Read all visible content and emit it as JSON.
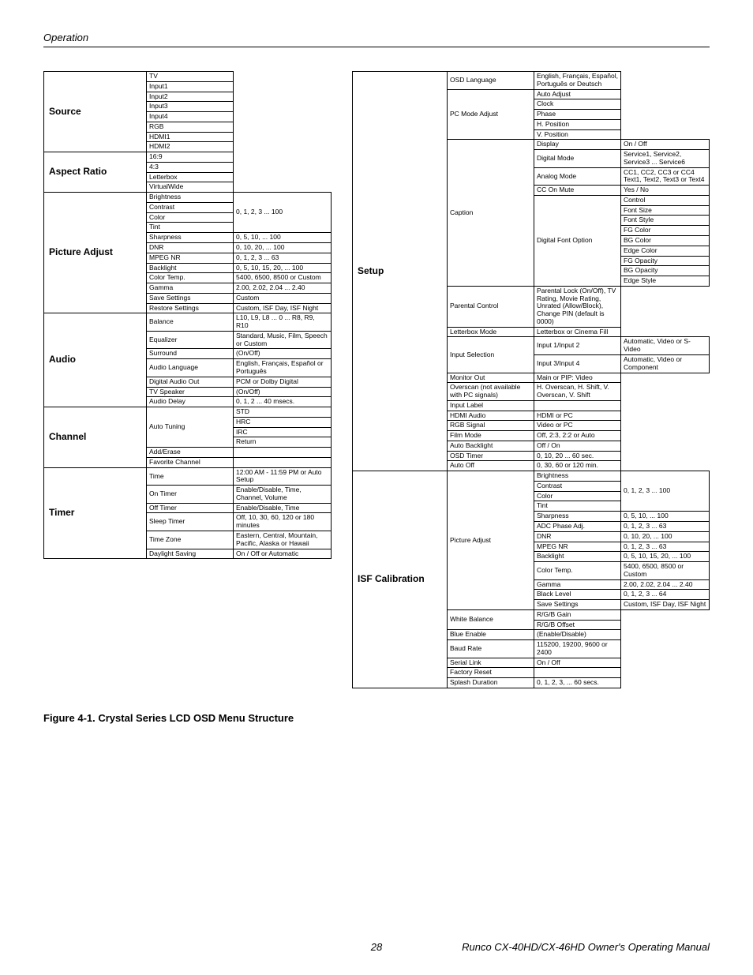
{
  "header": "Operation",
  "figure_caption": "Figure 4-1. Crystal Series LCD OSD Menu Structure",
  "footer_left": "",
  "footer_page": "28",
  "footer_right": "Runco CX-40HD/CX-46HD Owner's Operating Manual",
  "left": {
    "source": {
      "title": "Source",
      "items": [
        "TV",
        "Input1",
        "Input2",
        "Input3",
        "Input4",
        "RGB",
        "HDMI1",
        "HDMI2"
      ]
    },
    "aspect": {
      "title": "Aspect Ratio",
      "items": [
        "16:9",
        "4:3",
        "Letterbox",
        "VirtualWide"
      ]
    },
    "picture": {
      "title": "Picture Adjust",
      "rows": [
        [
          "Brightness",
          ""
        ],
        [
          "Contrast",
          ""
        ],
        [
          "Color",
          ""
        ],
        [
          "Tint",
          ""
        ],
        [
          "Sharpness",
          "0, 5, 10, ... 100"
        ],
        [
          "DNR",
          "0, 10, 20, ... 100"
        ],
        [
          "MPEG NR",
          "0, 1, 2, 3 ... 63"
        ],
        [
          "Backlight",
          "0, 5, 10, 15, 20, ... 100"
        ],
        [
          "Color Temp.",
          "5400, 6500, 8500 or Custom"
        ],
        [
          "Gamma",
          "2.00, 2.02, 2.04 ... 2.40"
        ],
        [
          "Save Settings",
          "Custom"
        ],
        [
          "Restore Settings",
          "Custom, ISF Day, ISF Night"
        ]
      ],
      "mergedVal": "0, 1, 2, 3 ... 100"
    },
    "audio": {
      "title": "Audio",
      "rows": [
        [
          "Balance",
          "L10, L9, L8 ... 0 ... R8, R9, R10"
        ],
        [
          "Equalizer",
          "Standard, Music, Film, Speech or Custom"
        ],
        [
          "Surround",
          "(On/Off)"
        ],
        [
          "Audio Language",
          "English, Français, Español or Português"
        ],
        [
          "Digital Audio Out",
          "PCM or Dolby Digital"
        ],
        [
          "TV Speaker",
          "(On/Off)"
        ],
        [
          "Audio Delay",
          "0, 1, 2 ... 40 msecs."
        ]
      ]
    },
    "channel": {
      "title": "Channel",
      "rows": [
        [
          "Auto Tuning",
          "STD"
        ],
        [
          "",
          "HRC"
        ],
        [
          "",
          "IRC"
        ],
        [
          "",
          "Return"
        ],
        [
          "Add/Erase",
          ""
        ],
        [
          "Favorite Channel",
          ""
        ]
      ]
    },
    "timer": {
      "title": "Timer",
      "rows": [
        [
          "Time",
          "12:00 AM - 11:59 PM or Auto Setup"
        ],
        [
          "On Timer",
          "Enable/Disable, Time, Channel, Volume"
        ],
        [
          "Off Timer",
          "Enable/Disable, Time"
        ],
        [
          "Sleep Timer",
          "Off, 10, 30, 60, 120 or 180 minutes"
        ],
        [
          "Time Zone",
          "Eastern, Central, Mountain, Pacific, Alaska or Hawaii"
        ],
        [
          "Daylight Saving",
          "On / Off or Automatic"
        ]
      ]
    }
  },
  "right": {
    "setup": {
      "title": "Setup",
      "rows": [
        {
          "a": "OSD Language",
          "b": "English, Français, Español, Português or Deutsch",
          "c": "",
          "aSpan": 1,
          "bSpan": 1
        },
        {
          "a": "PC Mode Adjust",
          "b": "Auto Adjust",
          "c": "",
          "aSpan": 5
        },
        {
          "b": "Clock",
          "c": ""
        },
        {
          "b": "Phase",
          "c": ""
        },
        {
          "b": "H. Position",
          "c": ""
        },
        {
          "b": "V. Position",
          "c": ""
        },
        {
          "a": "Caption",
          "b": "Display",
          "c": "On / Off",
          "aSpan": 12
        },
        {
          "b": "Digital Mode",
          "c": "Service1, Service2, Service3 ... Service6"
        },
        {
          "b": "Analog Mode",
          "c": "CC1, CC2, CC3 or CC4 Text1, Text2, Text3 or Text4"
        },
        {
          "b": "CC On Mute",
          "c": "Yes / No"
        },
        {
          "b": "Digital Font Option",
          "c": "Control",
          "bSpan": 8
        },
        {
          "c": "Font Size"
        },
        {
          "c": "Font Style"
        },
        {
          "c": "FG Color"
        },
        {
          "c": "BG Color"
        },
        {
          "c": "Edge Color"
        },
        {
          "c": "FG Opacity"
        },
        {
          "c": "BG Opacity"
        },
        {
          "c": "Edge Style"
        },
        {
          "a": "Parental Control",
          "b": "Parental Lock (On/Off), TV Rating, Movie Rating, Unrated (Allow/Block), Change PIN (default is 0000)",
          "c": ""
        },
        {
          "a": "Letterbox Mode",
          "b": "Letterbox or Cinema Fill",
          "c": ""
        },
        {
          "a": "Input Selection",
          "b": "Input 1/Input 2",
          "c": "Automatic, Video or S-Video",
          "aSpan": 2
        },
        {
          "b": "Input 3/Input 4",
          "c": "Automatic, Video or Component"
        },
        {
          "a": "Monitor Out",
          "b": "Main or PIP: Video",
          "c": ""
        },
        {
          "a": "Overscan (not available with PC signals)",
          "b": "H. Overscan, H. Shift, V. Overscan, V. Shift",
          "c": ""
        },
        {
          "a": "Input Label",
          "b": "",
          "c": ""
        },
        {
          "a": "HDMI Audio",
          "b": "HDMI or PC",
          "c": ""
        },
        {
          "a": "RGB Signal",
          "b": "Video or PC",
          "c": ""
        },
        {
          "a": "Film Mode",
          "b": "Off, 2:3, 2:2 or Auto",
          "c": ""
        },
        {
          "a": "Auto Backlight",
          "b": "Off / On",
          "c": ""
        },
        {
          "a": "OSD Timer",
          "b": "0, 10, 20 ... 60 sec.",
          "c": ""
        },
        {
          "a": "Auto Off",
          "b": "0, 30, 60 or 120 min.",
          "c": ""
        }
      ]
    },
    "isf": {
      "title": "ISF Calibration",
      "rows": [
        {
          "a": "Picture Adjust",
          "b": "Brightness",
          "c": "",
          "aSpan": 12,
          "cSpan": 4,
          "cVal": "0, 1, 2, 3 ... 100"
        },
        {
          "b": "Contrast"
        },
        {
          "b": "Color"
        },
        {
          "b": "Tint"
        },
        {
          "b": "Sharpness",
          "c": "0, 5, 10, ... 100"
        },
        {
          "b": "ADC Phase Adj.",
          "c": "0, 1, 2, 3 ... 63"
        },
        {
          "b": "DNR",
          "c": "0, 10, 20, ... 100"
        },
        {
          "b": "MPEG NR",
          "c": "0, 1, 2, 3 ... 63"
        },
        {
          "b": "Backlight",
          "c": "0, 5, 10, 15, 20, ... 100"
        },
        {
          "b": "Color Temp.",
          "c": "5400, 6500, 8500 or Custom"
        },
        {
          "b": "Gamma",
          "c": "2.00, 2.02, 2.04 ... 2.40"
        },
        {
          "b": "Black Level",
          "c": "0, 1, 2, 3 ... 64"
        },
        {
          "a": "",
          "b": "Save Settings",
          "c": "Custom, ISF Day, ISF Night",
          "aHidden": true
        },
        {
          "a": "White Balance",
          "b": "R/G/B Gain",
          "c": "",
          "aSpan": 2
        },
        {
          "b": "R/G/B Offset",
          "c": ""
        },
        {
          "a": "Blue Enable",
          "b": "(Enable/Disable)",
          "c": ""
        },
        {
          "a": "Baud Rate",
          "b": "115200, 19200, 9600 or 2400",
          "c": ""
        },
        {
          "a": "Serial Link",
          "b": "On / Off",
          "c": ""
        },
        {
          "a": "Factory Reset",
          "b": "",
          "c": ""
        },
        {
          "a": "Splash Duration",
          "b": "0, 1, 2, 3, ... 60 secs.",
          "c": ""
        }
      ]
    }
  }
}
